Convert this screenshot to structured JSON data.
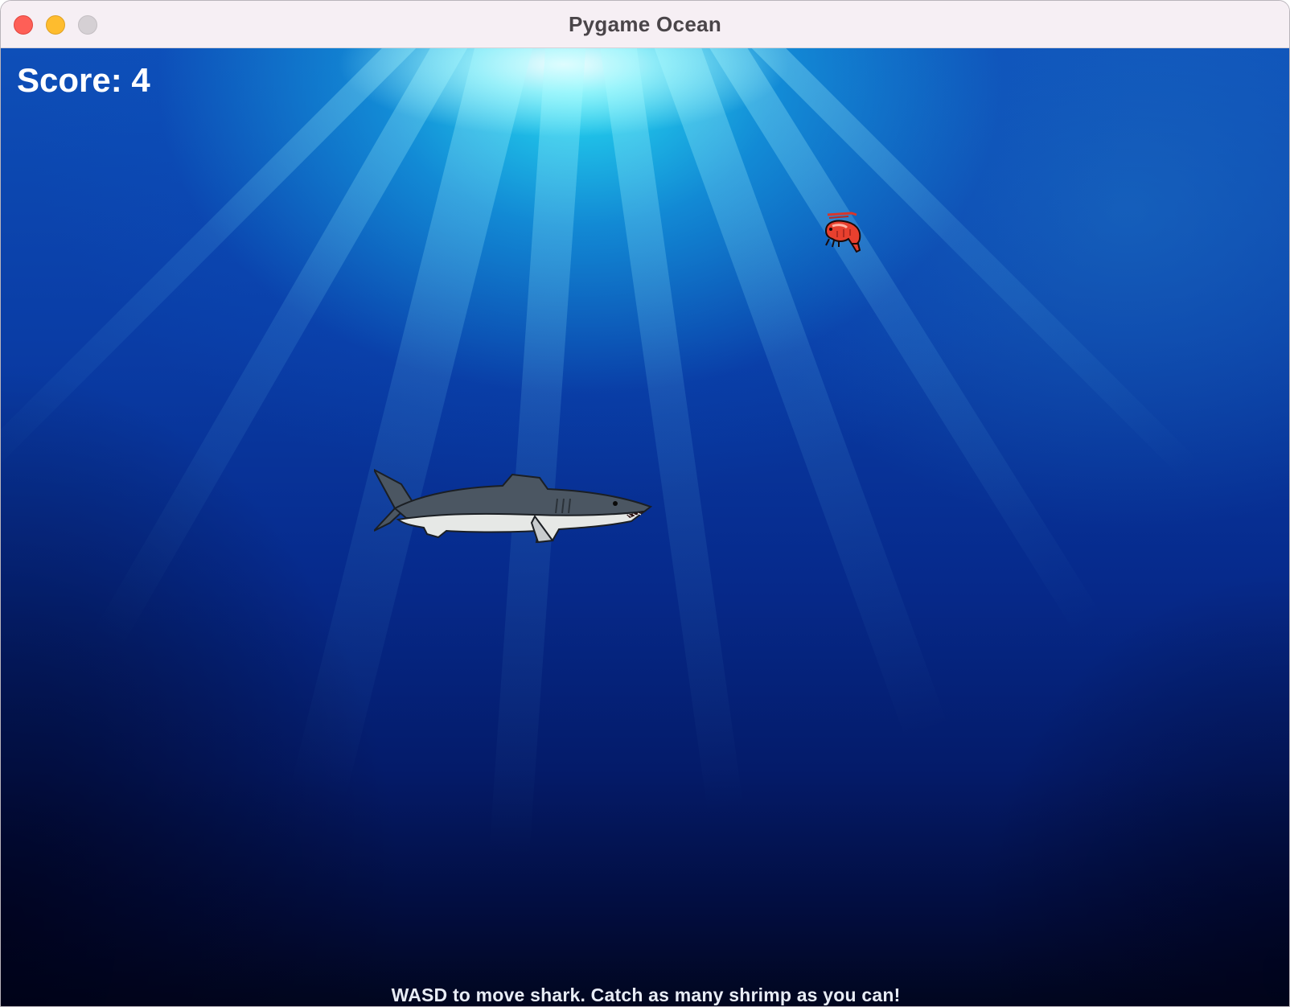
{
  "window": {
    "title": "Pygame Ocean"
  },
  "hud": {
    "score_label": "Score: 4",
    "score": 4,
    "instructions": "WASD to move shark. Catch as many shrimp as you can!"
  },
  "sprites": {
    "player": "shark-sprite",
    "target": "shrimp-sprite"
  },
  "colors": {
    "close_button": "#fe5f57",
    "minimize_button": "#febc2e",
    "zoom_button": "#d5d0d4",
    "shrimp": "#e8402e",
    "shark_back": "#4b5662",
    "shark_belly": "#e6e8e6"
  }
}
